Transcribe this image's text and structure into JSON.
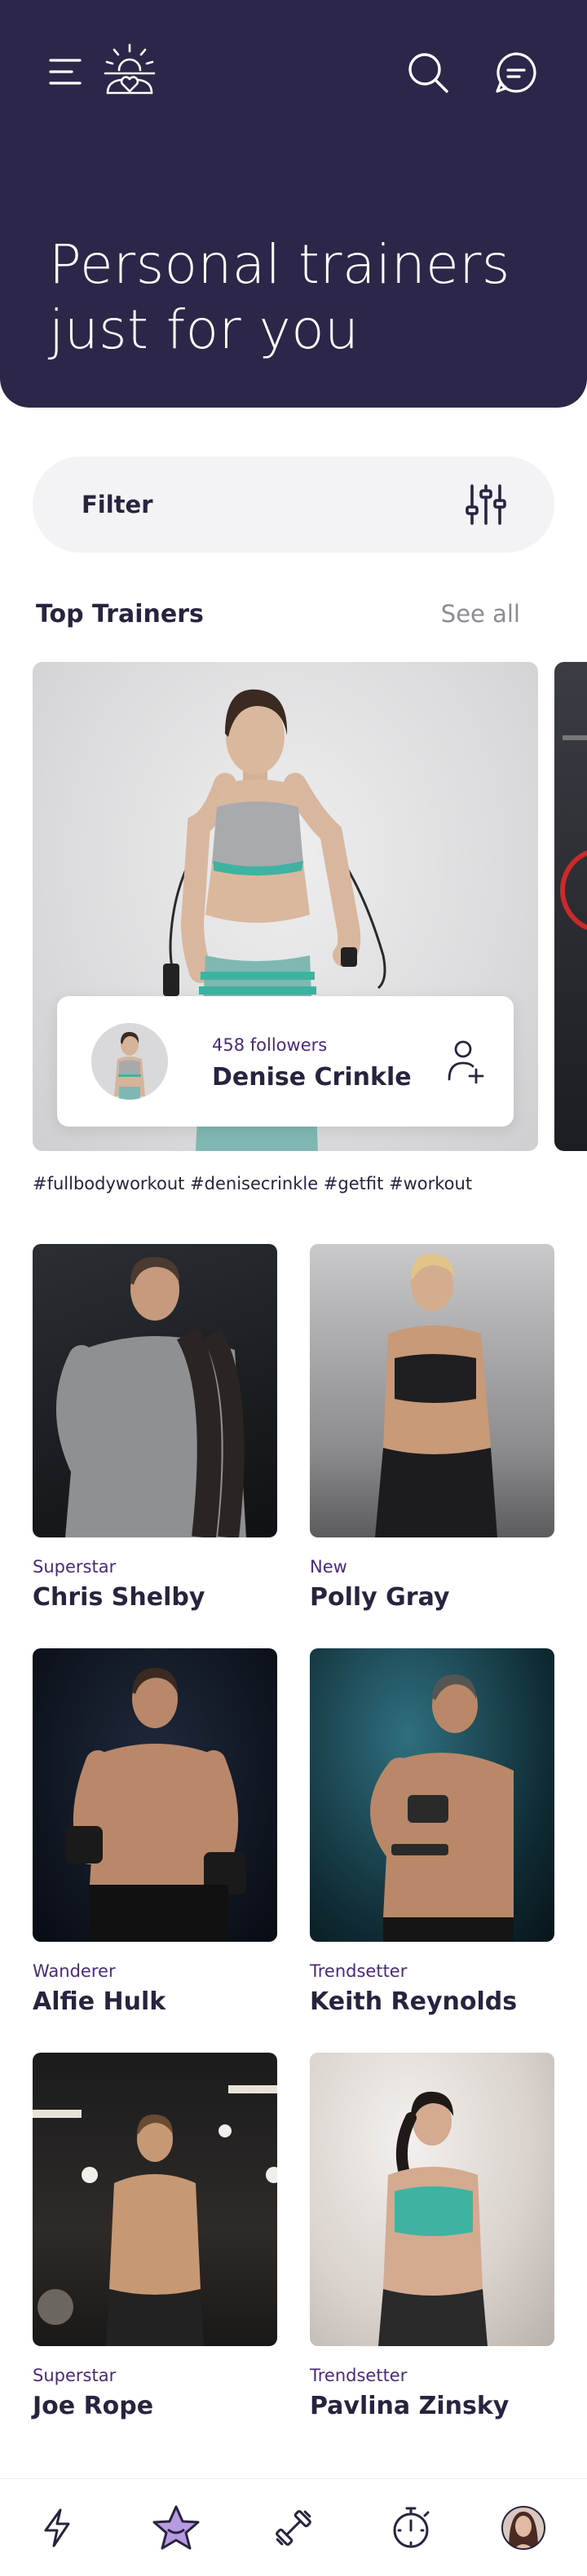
{
  "header": {
    "title_line1": "Personal trainers",
    "title_line2": "just for you",
    "icons": [
      "menu-icon",
      "logo-icon",
      "search-icon",
      "chat-icon"
    ]
  },
  "filter": {
    "label": "Filter",
    "icon": "sliders-icon"
  },
  "top_trainers": {
    "title": "Top Trainers",
    "see_all": "See all",
    "featured": {
      "followers": "458 followers",
      "name": "Denise Crinkle",
      "hashtags": "#fullbodyworkout #denisecrinkle #getfit #workout",
      "icon": "add-user-icon"
    }
  },
  "trainers": [
    {
      "tag": "Superstar",
      "name": "Chris Shelby"
    },
    {
      "tag": "New",
      "name": "Polly Gray"
    },
    {
      "tag": "Wanderer",
      "name": "Alfie Hulk"
    },
    {
      "tag": "Trendsetter",
      "name": "Keith Reynolds"
    },
    {
      "tag": "Superstar",
      "name": "Joe Rope"
    },
    {
      "tag": "Trendsetter",
      "name": "Pavlina Zinsky"
    }
  ],
  "tabbar": {
    "items": [
      "lightning-icon",
      "star-icon",
      "dumbbell-icon",
      "stopwatch-icon",
      "profile-avatar"
    ],
    "active": "star-icon"
  },
  "colors": {
    "hero_bg": "#2c2648",
    "accent_purple": "#4b2a7a",
    "active_tab": "#b79be0",
    "filter_bg": "#f3f2f4"
  }
}
